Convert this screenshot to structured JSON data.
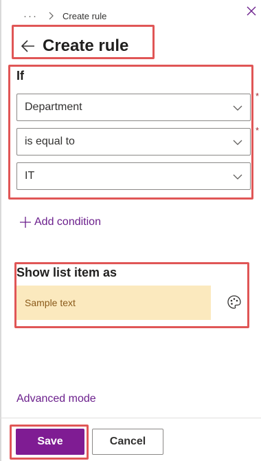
{
  "breadcrumb": {
    "more": "···",
    "current": "Create rule"
  },
  "title": "Create rule",
  "if_section": {
    "label": "If",
    "dropdowns": [
      {
        "value": "Department",
        "required": "*"
      },
      {
        "value": "is equal to",
        "required": "*"
      },
      {
        "value": "IT",
        "required": ""
      }
    ],
    "add_condition": "Add condition"
  },
  "show_section": {
    "label": "Show list item as",
    "sample_text": "Sample text"
  },
  "advanced_mode": "Advanced mode",
  "footer": {
    "save": "Save",
    "cancel": "Cancel"
  },
  "colors": {
    "accent": "#7f1c93",
    "link": "#6b1f8c",
    "highlight_box": "#e05656",
    "sample_bg": "#fbe9be"
  },
  "icons": [
    "more-icon",
    "chevron-right-icon",
    "close-icon",
    "back-arrow-icon",
    "chevron-down-icon",
    "plus-icon",
    "palette-icon"
  ]
}
